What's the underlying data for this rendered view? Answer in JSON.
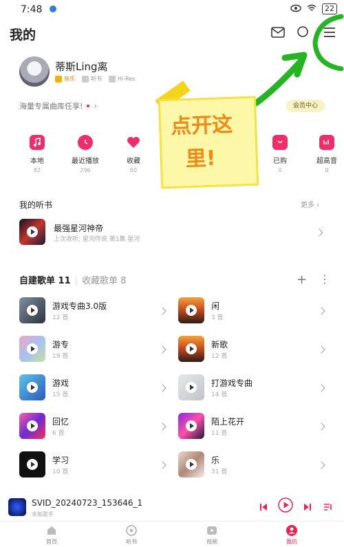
{
  "status": {
    "time": "7:48",
    "battery": "22"
  },
  "header": {
    "title": "我的"
  },
  "profile": {
    "name": "蒂斯Ling离",
    "badges": [
      {
        "label": "音乐"
      },
      {
        "label": "听书"
      },
      {
        "label": "Hi-Res"
      }
    ],
    "promo_text": "海量专属曲库任享!",
    "vip_button": "会员中心"
  },
  "quick_actions": [
    {
      "label": "本地",
      "count": "82",
      "color": "#ee2d6b"
    },
    {
      "label": "最近播放",
      "count": "296",
      "color": "#ee2d6b"
    },
    {
      "label": "收藏",
      "count": "60",
      "color": "#ee2d6b"
    },
    {
      "label": "已购",
      "count": "0",
      "color": "#ee2d6b"
    },
    {
      "label": "超高音",
      "count": "0",
      "color": "#ee2d6b"
    }
  ],
  "annotation": {
    "line1": "点开这",
    "line2": "里!"
  },
  "audiobooks": {
    "title": "我的听书",
    "more": "更多",
    "item": {
      "title": "最强星河神帝",
      "subtitle": "上次收听: 星河传说 第1集 星河"
    }
  },
  "playlists": {
    "created_tab": "自建歌单 11",
    "collected_tab": "收藏歌单 8",
    "left": [
      {
        "name": "游戏专曲3.0版",
        "count": "12 首"
      },
      {
        "name": "游专",
        "count": "19 首"
      },
      {
        "name": "游戏",
        "count": "15 首"
      },
      {
        "name": "回忆",
        "count": "6 首"
      },
      {
        "name": "学习",
        "count": "10 首"
      }
    ],
    "right": [
      {
        "name": "闲",
        "count": "3 首"
      },
      {
        "name": "新歌",
        "count": "12 首"
      },
      {
        "name": "打游戏专曲",
        "count": "14 首"
      },
      {
        "name": "陌上花开",
        "count": "11 首"
      },
      {
        "name": "乐",
        "count": "31 首"
      }
    ]
  },
  "player": {
    "title": "SVID_20240723_153646_1",
    "artist": "未知歌手"
  },
  "tabs": [
    {
      "label": "首页"
    },
    {
      "label": "听书"
    },
    {
      "label": "视频"
    },
    {
      "label": "我的"
    }
  ],
  "colors": {
    "accent": "#e8234f",
    "annotation_green": "#25b523",
    "sticky_yellow": "#fdf7a8"
  }
}
